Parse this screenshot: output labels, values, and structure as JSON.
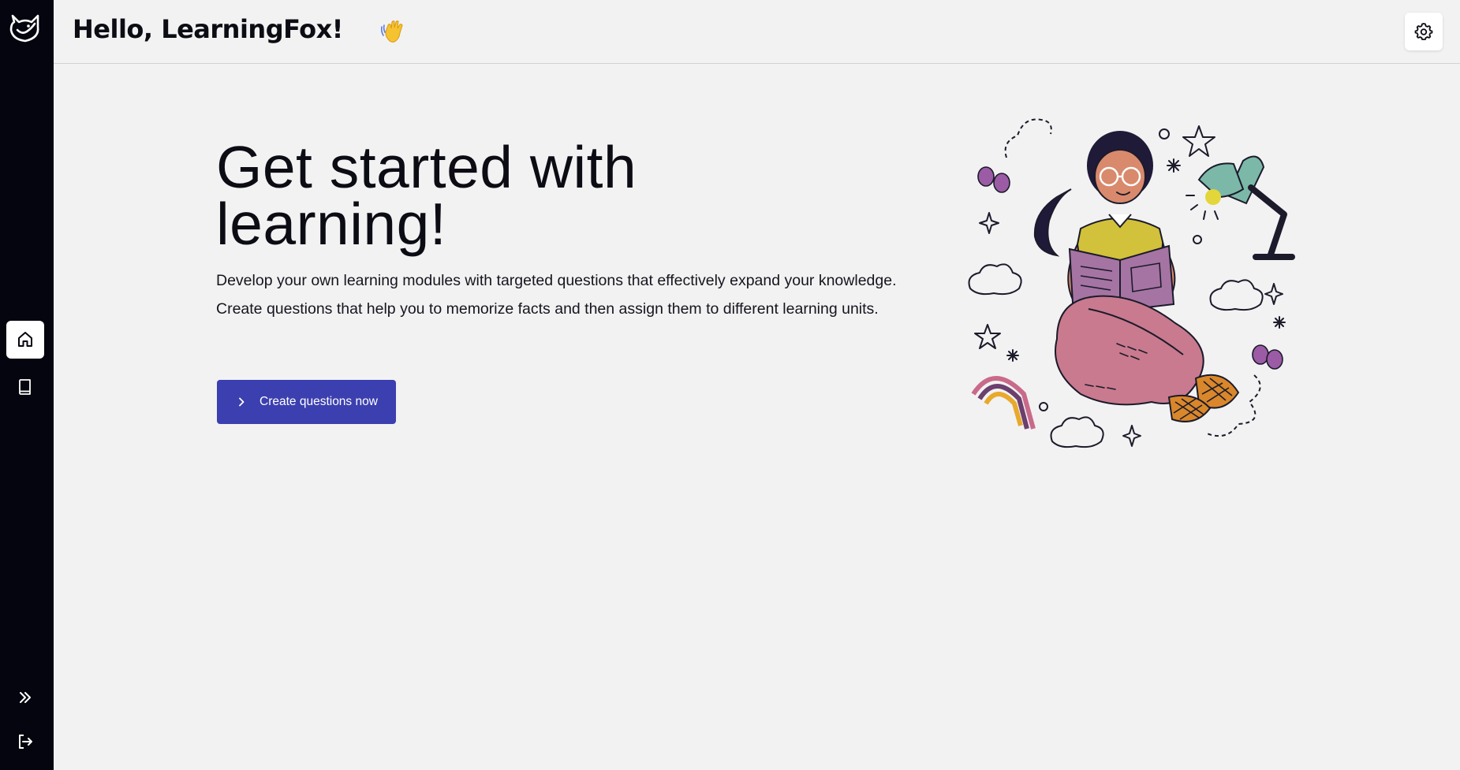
{
  "header": {
    "greeting": "Hello, LearningFox!",
    "wave_emoji": "👋"
  },
  "sidebar": {
    "items": [
      {
        "name": "home",
        "icon": "home-icon",
        "active": true
      },
      {
        "name": "learning-units",
        "icon": "book-icon",
        "active": false
      }
    ],
    "bottom": [
      {
        "name": "expand",
        "icon": "double-chevron-right-icon"
      },
      {
        "name": "logout",
        "icon": "logout-icon"
      }
    ]
  },
  "main": {
    "title": "Get started with learning!",
    "description": "Develop your own learning modules with targeted questions that effectively expand your knowledge. Create questions that help you to memorize facts and then assign them to different learning units.",
    "cta_label": "Create questions now"
  },
  "colors": {
    "sidebar_bg": "#05050f",
    "page_bg": "#f2f2f2",
    "accent": "#3c3faf"
  }
}
